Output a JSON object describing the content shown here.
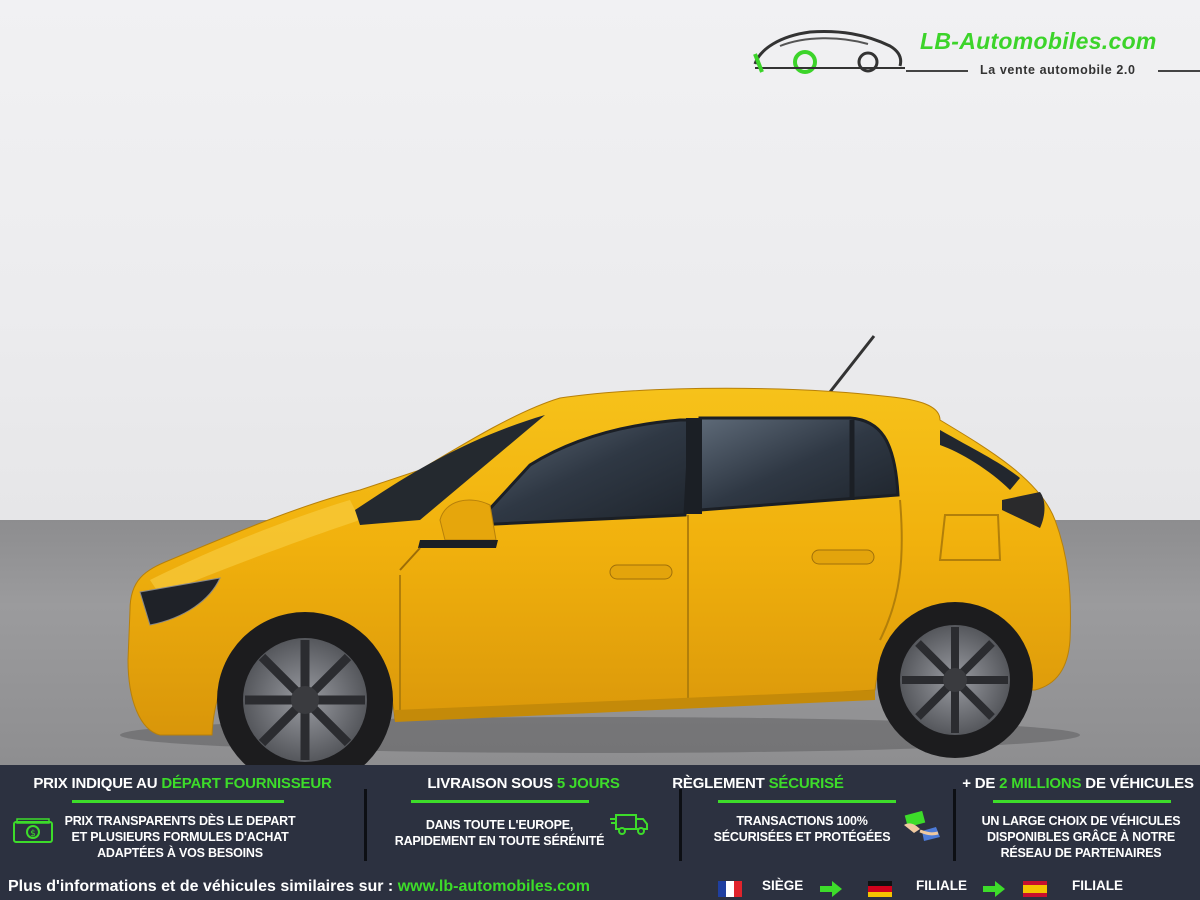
{
  "logo": {
    "name": "LB-Automobiles.com",
    "tagline": "La vente automobile 2.0"
  },
  "photo": {
    "subject": "yellow hatchback side view",
    "colors": {
      "body": "#f2b20f",
      "window": "#2a2f36",
      "tire": "#1c1c1e",
      "rim": "#6e7075"
    }
  },
  "info_blocks": [
    {
      "heading_prefix": "PRIX INDIQUE AU ",
      "heading_highlight": "DÉPART FOURNISSEUR",
      "heading_suffix": "",
      "lines": [
        "PRIX TRANSPARENTS DÈS LE DEPART",
        "ET PLUSIEURS FORMULES D'ACHAT",
        "ADAPTÉES À VOS BESOINS"
      ],
      "icon": "banknote-icon"
    },
    {
      "heading_prefix": "LIVRAISON SOUS ",
      "heading_highlight": "5 JOURS",
      "heading_suffix": "",
      "lines": [
        "DANS TOUTE L'EUROPE,",
        "RAPIDEMENT EN TOUTE SÉRÉNITÉ"
      ],
      "icon": "delivery-truck-icon"
    },
    {
      "heading_prefix": "RÈGLEMENT ",
      "heading_highlight": "SÉCURISÉ",
      "heading_suffix": "",
      "lines": [
        "TRANSACTIONS 100%",
        "SÉCURISÉES ET PROTÉGÉES"
      ],
      "icon": "payment-hands-icon"
    },
    {
      "heading_prefix": "+ DE ",
      "heading_highlight": "2 MILLIONS",
      "heading_suffix": " DE VÉHICULES",
      "lines": [
        "UN LARGE CHOIX DE VÉHICULES",
        "DISPONIBLES GRÂCE À NOTRE",
        "RÉSEAU DE PARTENAIRES"
      ],
      "icon": ""
    }
  ],
  "footer": {
    "text": "Plus d'informations et de véhicules similaires sur : ",
    "link": "www.lb-automobiles.com",
    "locations": [
      {
        "flag": "france-flag-icon",
        "label": "SIÈGE"
      },
      {
        "flag": "germany-flag-icon",
        "label": "FILIALE"
      },
      {
        "flag": "spain-flag-icon",
        "label": "FILIALE"
      }
    ]
  },
  "colors": {
    "accent": "#3ddc2a",
    "band": "#2c3140"
  }
}
